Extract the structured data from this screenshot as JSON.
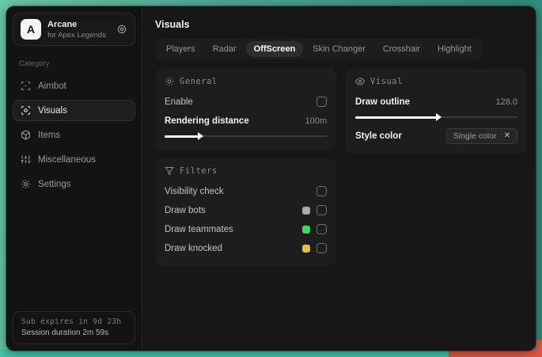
{
  "colors": {
    "bg_teal": "#4aa890",
    "bg_bottom_teal": "#41c3a7",
    "bg_red": "#dc5943",
    "slider_fill": "#ffffff"
  },
  "sidebar": {
    "app": {
      "logo_letter": "A",
      "name": "Arcane",
      "subtitle": "for Apex Legends"
    },
    "category_label": "Category",
    "items": [
      {
        "label": "Aimbot",
        "icon": "crosshair-scan-icon",
        "selected": false
      },
      {
        "label": "Visuals",
        "icon": "eye-scan-icon",
        "selected": true
      },
      {
        "label": "Items",
        "icon": "cube-icon",
        "selected": false
      },
      {
        "label": "Miscellaneous",
        "icon": "sliders-icon",
        "selected": false
      },
      {
        "label": "Settings",
        "icon": "gear-icon",
        "selected": false
      }
    ],
    "footer": {
      "line1": "Sub expires in 9d 23h",
      "line2": "Session duration 2m 59s"
    }
  },
  "main": {
    "title": "Visuals",
    "tabs": [
      {
        "label": "Players",
        "selected": false
      },
      {
        "label": "Radar",
        "selected": false
      },
      {
        "label": "OffScreen",
        "selected": true
      },
      {
        "label": "Skin Changer",
        "selected": false
      },
      {
        "label": "Crosshair",
        "selected": false
      },
      {
        "label": "Highlight",
        "selected": false
      }
    ],
    "panels": {
      "general": {
        "title": "General",
        "enable_label": "Enable",
        "enable_checked": false,
        "rendering_distance_label": "Rendering distance",
        "rendering_distance_value": "100m",
        "rendering_distance_percent": 21
      },
      "visual": {
        "title": "Visual",
        "draw_outline_label": "Draw outline",
        "draw_outline_value": "128.0",
        "draw_outline_percent": 50,
        "style_color_label": "Style color",
        "style_color_value": "Single color",
        "style_color_clear": "✕"
      },
      "filters": {
        "title": "Filters",
        "rows": [
          {
            "label": "Visibility check",
            "checked": false
          },
          {
            "label": "Draw bots",
            "swatch": "#a9a9a9",
            "checked": false
          },
          {
            "label": "Draw teammates",
            "swatch": "#43d95e",
            "checked": false
          },
          {
            "label": "Draw knocked",
            "swatch": "#ddc043",
            "checked": false
          }
        ]
      }
    }
  }
}
